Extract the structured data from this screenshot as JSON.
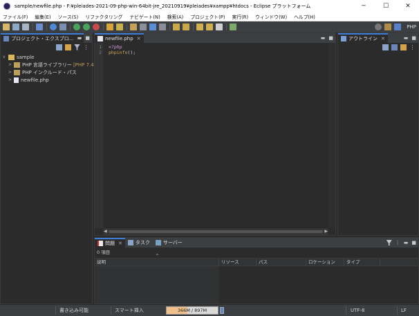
{
  "window": {
    "title": "sample/newfile.php - F:¥pleiades-2021-09-php-win-64bit-jre_20210919¥pleiades¥xampp¥htdocs - Eclipse プラットフォーム",
    "minimize": "─",
    "maximize": "☐",
    "close": "✕"
  },
  "menu": {
    "items": [
      "ファイル(F)",
      "編集(E)",
      "ソース(S)",
      "リファクタリング",
      "ナビゲート(N)",
      "検索(A)",
      "プロジェクト(P)",
      "実行(R)",
      "ウィンドウ(W)",
      "ヘルプ(H)"
    ]
  },
  "toolbar": {
    "perspective_label": "PHP"
  },
  "explorer": {
    "tab_label": "プロジェクト・エクスプロ...",
    "tab_close": "✕",
    "tree": {
      "project": "sample",
      "children": [
        {
          "label": "PHP 言語ライブラリー",
          "suffix": "[PHP 7.4]"
        },
        {
          "label": "PHP インクルード・パス",
          "suffix": ""
        },
        {
          "label": "newfile.php",
          "suffix": ""
        }
      ]
    }
  },
  "editor": {
    "tab_label": "newfile.php",
    "tab_close": "✕",
    "line_numbers": [
      "1",
      "2"
    ],
    "code": {
      "open_tag": "<?php",
      "func": "phpinfo",
      "call_suffix": "();"
    }
  },
  "outline": {
    "tab_label": "アウトライン",
    "tab_close": "✕"
  },
  "problems": {
    "tabs": [
      {
        "label": "問題",
        "close": "✕"
      },
      {
        "label": "タスク",
        "close": ""
      },
      {
        "label": "サーバー",
        "close": ""
      }
    ],
    "count": "0 項目",
    "columns": [
      "説明",
      "リソース",
      "パス",
      "ロケーション",
      "タイプ"
    ]
  },
  "status": {
    "writable": "書き込み可能",
    "insert_mode": "スマート挿入",
    "heap": "366M / 897M",
    "heap_fraction": 0.408,
    "encoding": "UTF-8",
    "line_delim": "LF"
  },
  "colors": {
    "accent": "#3d7ed8",
    "php_tag": "#e1a0e8",
    "function": "#d8a861"
  }
}
